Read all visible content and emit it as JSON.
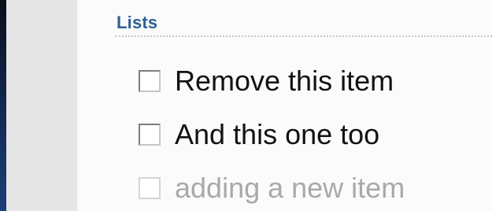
{
  "section": {
    "title": "Lists"
  },
  "list": {
    "items": [
      {
        "label": "Remove this item",
        "checked": false
      },
      {
        "label": "And this one too",
        "checked": false
      }
    ],
    "new_item": {
      "label": "adding a new item",
      "checked": false
    }
  },
  "colors": {
    "section_title": "#2f5f96",
    "item_text": "#121212",
    "placeholder_text": "#a9a9a9"
  }
}
